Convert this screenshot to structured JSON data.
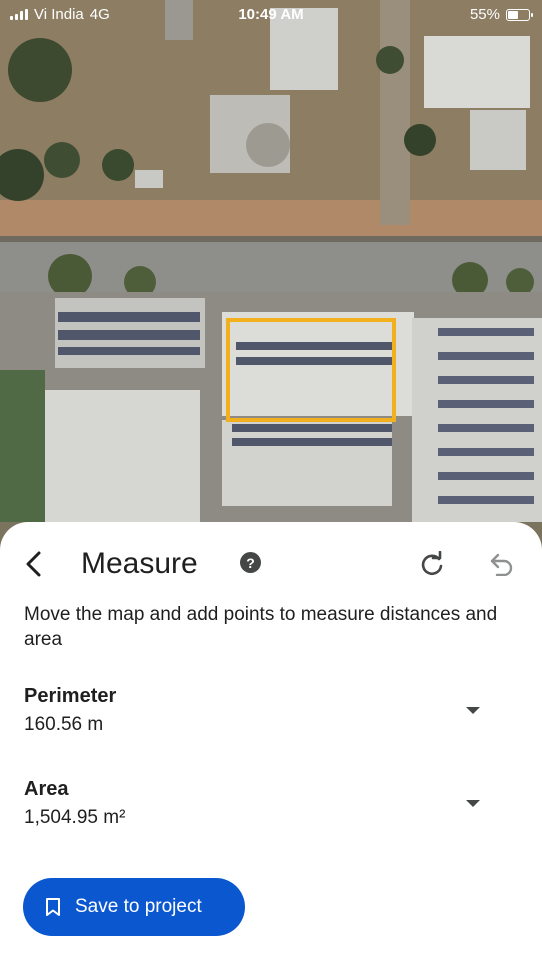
{
  "status_bar": {
    "carrier": "Vi India",
    "network": "4G",
    "time": "10:49 AM",
    "battery": "55%",
    "battery_level": 0.55
  },
  "map": {
    "selection_color": "#f2b01e"
  },
  "sheet": {
    "title": "Measure",
    "help_label": "?",
    "instructions": "Move the map and add points to measure distances and area",
    "perimeter": {
      "label": "Perimeter",
      "value": "160.56 m"
    },
    "area": {
      "label": "Area",
      "value": "1,504.95 m²"
    },
    "save_button": "Save to project"
  },
  "icons": [
    "back-arrow-icon",
    "help-icon",
    "redo-icon",
    "undo-icon",
    "chevron-down-icon",
    "bookmark-icon",
    "signal-icon",
    "battery-icon"
  ],
  "colors": {
    "accent": "#0b57d0",
    "text": "#1f1f1f",
    "icon": "#444746",
    "disabled_icon": "#8e918f"
  }
}
